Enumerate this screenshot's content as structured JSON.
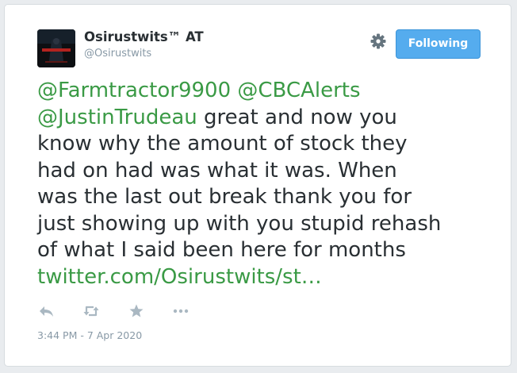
{
  "tweet": {
    "author": {
      "display_name": "Osirustwits™ AT",
      "handle": "@Osirustwits",
      "avatar_icon": "profile-avatar-dark-movie-poster"
    },
    "follow_button": {
      "label": "Following",
      "color": "#55acee"
    },
    "settings_icon": "gear-icon",
    "text_lines": [
      [
        {
          "text": "@Farmtractor9900 @CBCAlerts",
          "link": true
        }
      ],
      [
        {
          "text": "@JustinTrudeau",
          "link": true
        },
        {
          "text": " great and now you",
          "link": false
        }
      ],
      [
        {
          "text": "know why the amount of stock they",
          "link": false
        }
      ],
      [
        {
          "text": "had on had was what it was. When",
          "link": false
        }
      ],
      [
        {
          "text": "was the last out break thank you for",
          "link": false
        }
      ],
      [
        {
          "text": "just showing up with you stupid rehash",
          "link": false
        }
      ],
      [
        {
          "text": "of what I said been here for months",
          "link": false
        }
      ],
      [
        {
          "text": "twitter.com/Osirustwits/st…",
          "link": true
        }
      ]
    ],
    "link_color": "#3a9a45",
    "actions": [
      {
        "name": "reply-icon"
      },
      {
        "name": "retweet-icon"
      },
      {
        "name": "like-star-icon"
      },
      {
        "name": "more-icon"
      }
    ],
    "timestamp": "3:44 PM - 7 Apr 2020"
  }
}
